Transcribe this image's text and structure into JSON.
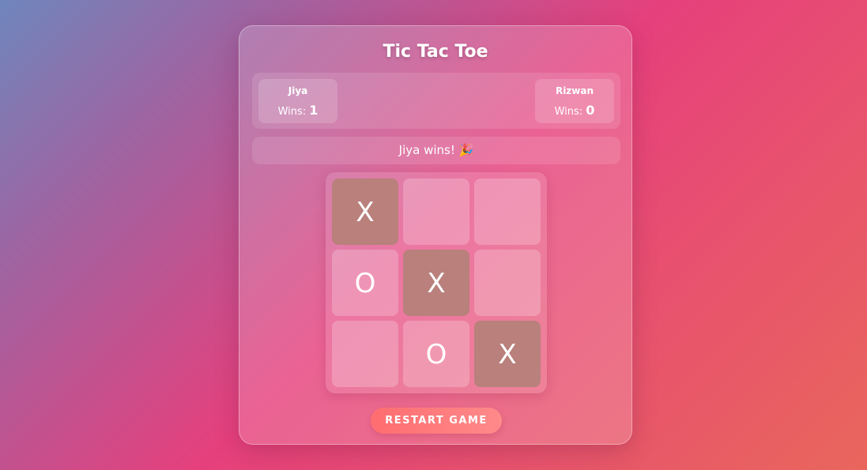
{
  "title": "Tic Tac Toe",
  "players": [
    {
      "name": "Jiya",
      "wins_label": "Wins:",
      "wins": "1"
    },
    {
      "name": "Rizwan",
      "wins_label": "Wins:",
      "wins": "0"
    }
  ],
  "status": "Jiya wins! 🎉",
  "board": {
    "cells": [
      "X",
      "",
      "",
      "O",
      "X",
      "",
      "",
      "O",
      "X"
    ],
    "winning_cells": [
      0,
      4,
      8
    ]
  },
  "restart_label": "RESTART GAME",
  "colors": {
    "win_cell": "#b9807c",
    "button_start": "#ff6d70",
    "button_end": "#ff8a8a"
  }
}
